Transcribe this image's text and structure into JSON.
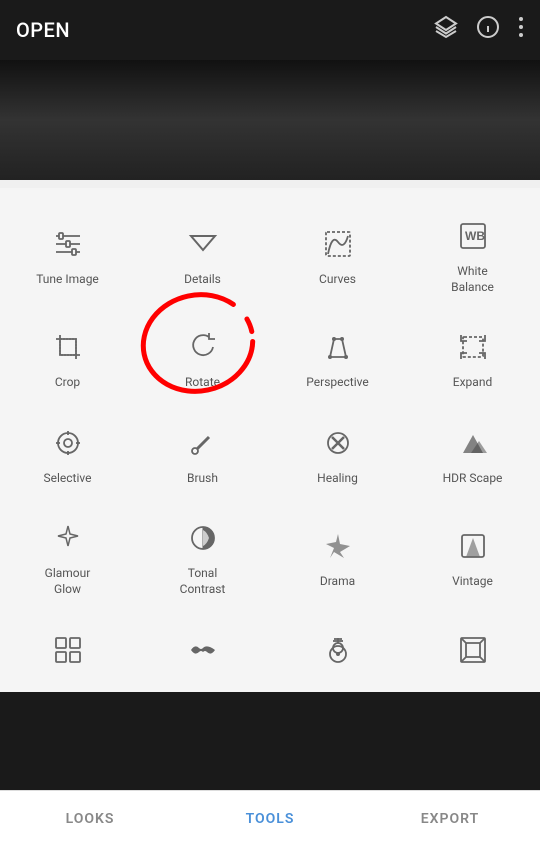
{
  "topBar": {
    "title": "OPEN",
    "icons": [
      "layers-icon",
      "info-icon",
      "more-icon"
    ]
  },
  "tools": [
    {
      "id": "tune-image",
      "label": "Tune Image"
    },
    {
      "id": "details",
      "label": "Details"
    },
    {
      "id": "curves",
      "label": "Curves"
    },
    {
      "id": "white-balance",
      "label": "White Balance"
    },
    {
      "id": "crop",
      "label": "Crop"
    },
    {
      "id": "rotate",
      "label": "Rotate"
    },
    {
      "id": "perspective",
      "label": "Perspective"
    },
    {
      "id": "expand",
      "label": "Expand"
    },
    {
      "id": "selective",
      "label": "Selective"
    },
    {
      "id": "brush",
      "label": "Brush"
    },
    {
      "id": "healing",
      "label": "Healing"
    },
    {
      "id": "hdr-scape",
      "label": "HDR Scape"
    },
    {
      "id": "glamour-glow",
      "label": "Glamour Glow"
    },
    {
      "id": "tonal-contrast",
      "label": "Tonal Contrast"
    },
    {
      "id": "drama",
      "label": "Drama"
    },
    {
      "id": "vintage",
      "label": "Vintage"
    },
    {
      "id": "grid1",
      "label": ""
    },
    {
      "id": "mustache",
      "label": ""
    },
    {
      "id": "guitar",
      "label": ""
    },
    {
      "id": "photo-frame",
      "label": ""
    }
  ],
  "bottomNav": [
    {
      "id": "looks",
      "label": "LOOKS",
      "active": false
    },
    {
      "id": "tools",
      "label": "TOOLS",
      "active": true
    },
    {
      "id": "export",
      "label": "EXPORT",
      "active": false
    }
  ],
  "accentColor": "#4a90d9"
}
